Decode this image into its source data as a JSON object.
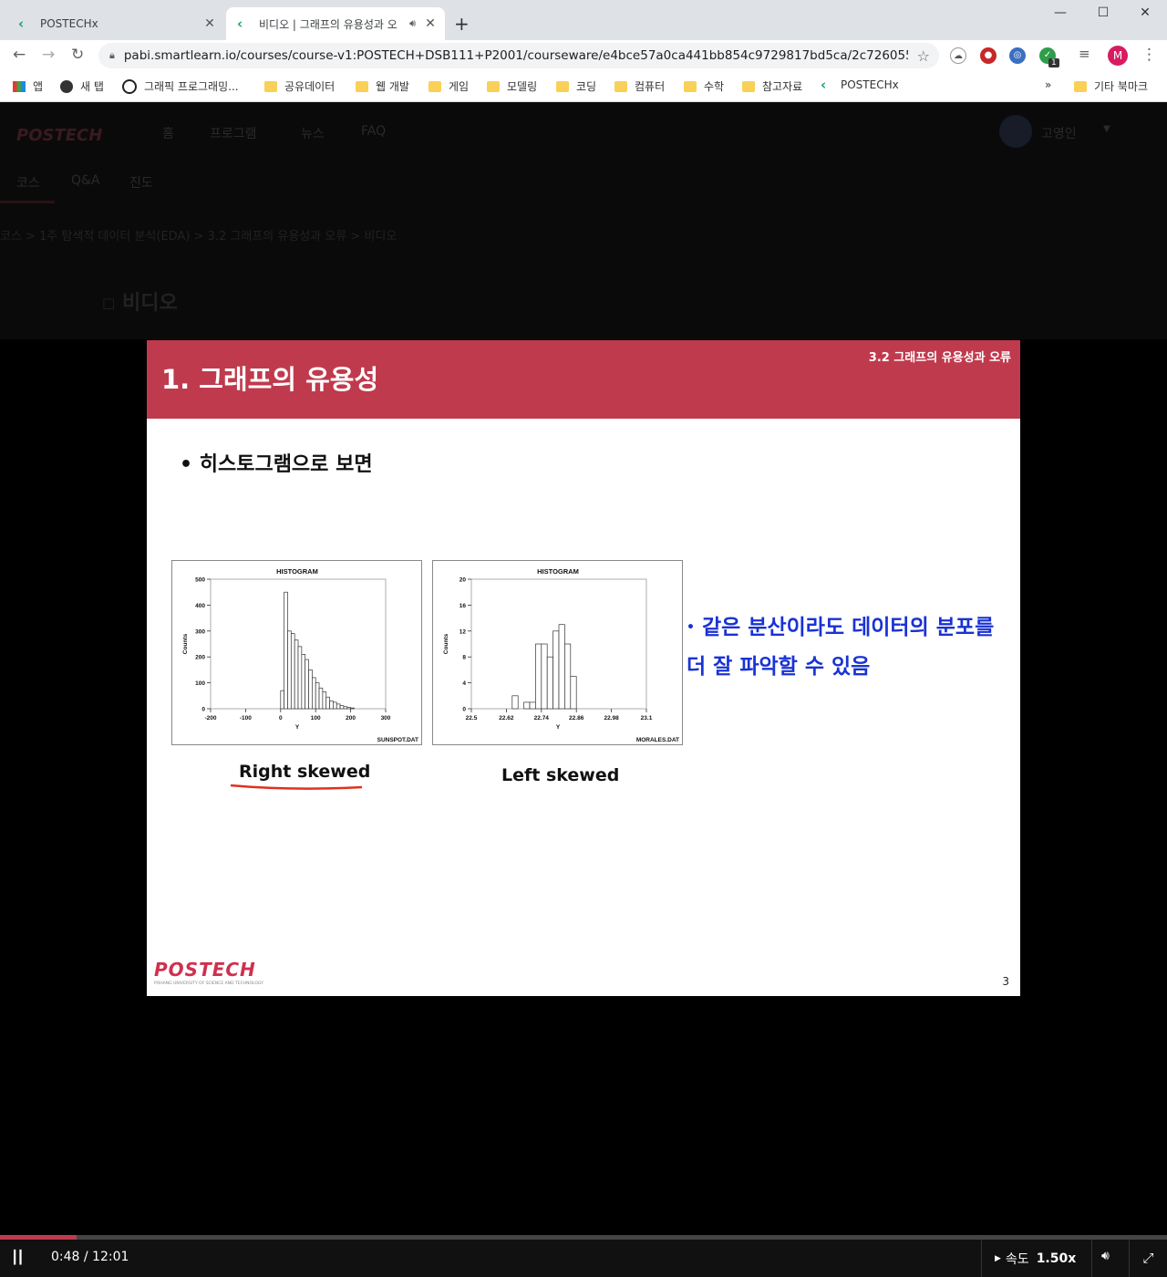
{
  "browser": {
    "tabs": [
      {
        "title": "POSTECHx"
      },
      {
        "title": "비디오 | 그래프의 유용성과 오"
      }
    ],
    "new_tab": "+",
    "window": {
      "minimize": "—",
      "maximize": "☐",
      "close": "✕"
    },
    "url": "pabi.smartlearn.io/courses/course-v1:POSTECH+DSB111+P2001/courseware/e4bce57a0ca441bb854c9729817bd5ca/2c72605569064f7...",
    "profile_initial": "M",
    "ext_badge": "1",
    "bookmarks": [
      {
        "label": "앱",
        "icon": "apps-icon"
      },
      {
        "label": "새 탭",
        "icon": "globe-icon"
      },
      {
        "label": "그래픽 프로그래밍...",
        "icon": "unreal-icon"
      },
      {
        "label": "공유데이터",
        "icon": "folder-icon"
      },
      {
        "label": "웹 개발",
        "icon": "folder-icon"
      },
      {
        "label": "게임",
        "icon": "folder-icon"
      },
      {
        "label": "모델링",
        "icon": "folder-icon"
      },
      {
        "label": "코딩",
        "icon": "folder-icon"
      },
      {
        "label": "컴퓨터",
        "icon": "folder-icon"
      },
      {
        "label": "수학",
        "icon": "folder-icon"
      },
      {
        "label": "참고자료",
        "icon": "folder-icon"
      },
      {
        "label": "POSTECHx",
        "icon": "postechx-icon"
      }
    ],
    "bookmarks_overflow": "»",
    "other_bookmarks": "기타 북마크"
  },
  "site": {
    "logo": "POSTECH",
    "nav": [
      "홈",
      "프로그램",
      "뉴스",
      "FAQ"
    ],
    "user": "고영인",
    "tabs": [
      "코스",
      "Q&A",
      "진도"
    ],
    "breadcrumb": "코스 > 1주 탐색적 데이터 분석(EDA) > 3.2 그래프의 유용성과 오류 > 비디오",
    "page_title": "비디오"
  },
  "slide": {
    "title": "1. 그래프의 유용성",
    "section": "3.2 그래프의 유용성과 오류",
    "bullet1": "히스토그램으로 보면",
    "bullet2": "같은 분산이라도 데이터의 분포를 더 잘 파악할 수 있음",
    "caption_left": "Right skewed",
    "caption_right": "Left skewed",
    "logo": "POSTECH",
    "logo_sub": "POHANG UNIVERSITY OF SCIENCE AND TECHNOLOGY",
    "page": "3"
  },
  "chart_data": [
    {
      "type": "bar",
      "title": "HISTOGRAM",
      "xlabel": "Y",
      "ylabel": "Counts",
      "footer": "SUNSPOT.DAT",
      "xlim": [
        -200,
        300
      ],
      "ylim": [
        0,
        500
      ],
      "xticks": [
        "-200",
        "-100",
        "0",
        "100",
        "200",
        "300"
      ],
      "yticks": [
        "0",
        "100",
        "200",
        "300",
        "400",
        "500"
      ],
      "bin_width": 10,
      "bins_start": [
        0,
        10,
        20,
        30,
        40,
        50,
        60,
        70,
        80,
        90,
        100,
        110,
        120,
        130,
        140,
        150,
        160,
        170,
        180,
        190,
        200
      ],
      "values": [
        70,
        450,
        300,
        290,
        265,
        240,
        210,
        190,
        150,
        120,
        100,
        80,
        65,
        45,
        30,
        25,
        18,
        12,
        8,
        5,
        3
      ]
    },
    {
      "type": "bar",
      "title": "HISTOGRAM",
      "xlabel": "Y",
      "ylabel": "Counts",
      "footer": "MORALES.DAT",
      "xlim": [
        22.5,
        23.1
      ],
      "ylim": [
        0,
        20
      ],
      "xticks": [
        "22.5",
        "22.62",
        "22.74",
        "22.86",
        "22.98",
        "23.1"
      ],
      "yticks": [
        "0",
        "4",
        "8",
        "12",
        "16",
        "20"
      ],
      "bin_width": 0.02,
      "bins_start": [
        22.64,
        22.66,
        22.68,
        22.7,
        22.72,
        22.74,
        22.76,
        22.78,
        22.8,
        22.82,
        22.84
      ],
      "values": [
        2,
        0,
        1,
        1,
        10,
        10,
        8,
        12,
        13,
        10,
        5
      ]
    }
  ],
  "player": {
    "progress": 0.066,
    "time": "0:48 / 12:01",
    "speed_label": "속도",
    "speed_value": "1.50x"
  }
}
